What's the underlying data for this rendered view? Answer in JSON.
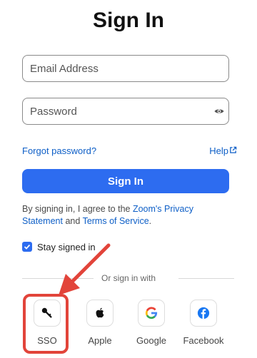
{
  "header": {
    "title": "Sign In"
  },
  "form": {
    "email_placeholder": "Email Address",
    "email_value": "",
    "password_placeholder": "Password",
    "password_value": ""
  },
  "links": {
    "forgot_password": "Forgot password?",
    "help": "Help"
  },
  "buttons": {
    "sign_in": "Sign In"
  },
  "terms": {
    "prefix": "By signing in, I agree to the ",
    "privacy": "Zoom's Privacy Statement",
    "middle": " and ",
    "tos": "Terms of Service",
    "suffix": "."
  },
  "stay_signed_in": {
    "label": "Stay signed in",
    "checked": true
  },
  "alt_signin": {
    "label": "Or sign in with",
    "providers": [
      {
        "label": "SSO",
        "icon": "key-icon"
      },
      {
        "label": "Apple",
        "icon": "apple-icon"
      },
      {
        "label": "Google",
        "icon": "google-icon"
      },
      {
        "label": "Facebook",
        "icon": "facebook-icon"
      }
    ]
  },
  "colors": {
    "primary": "#2d6cf0",
    "link": "#0e5fc7",
    "annotation": "#e2443a"
  }
}
